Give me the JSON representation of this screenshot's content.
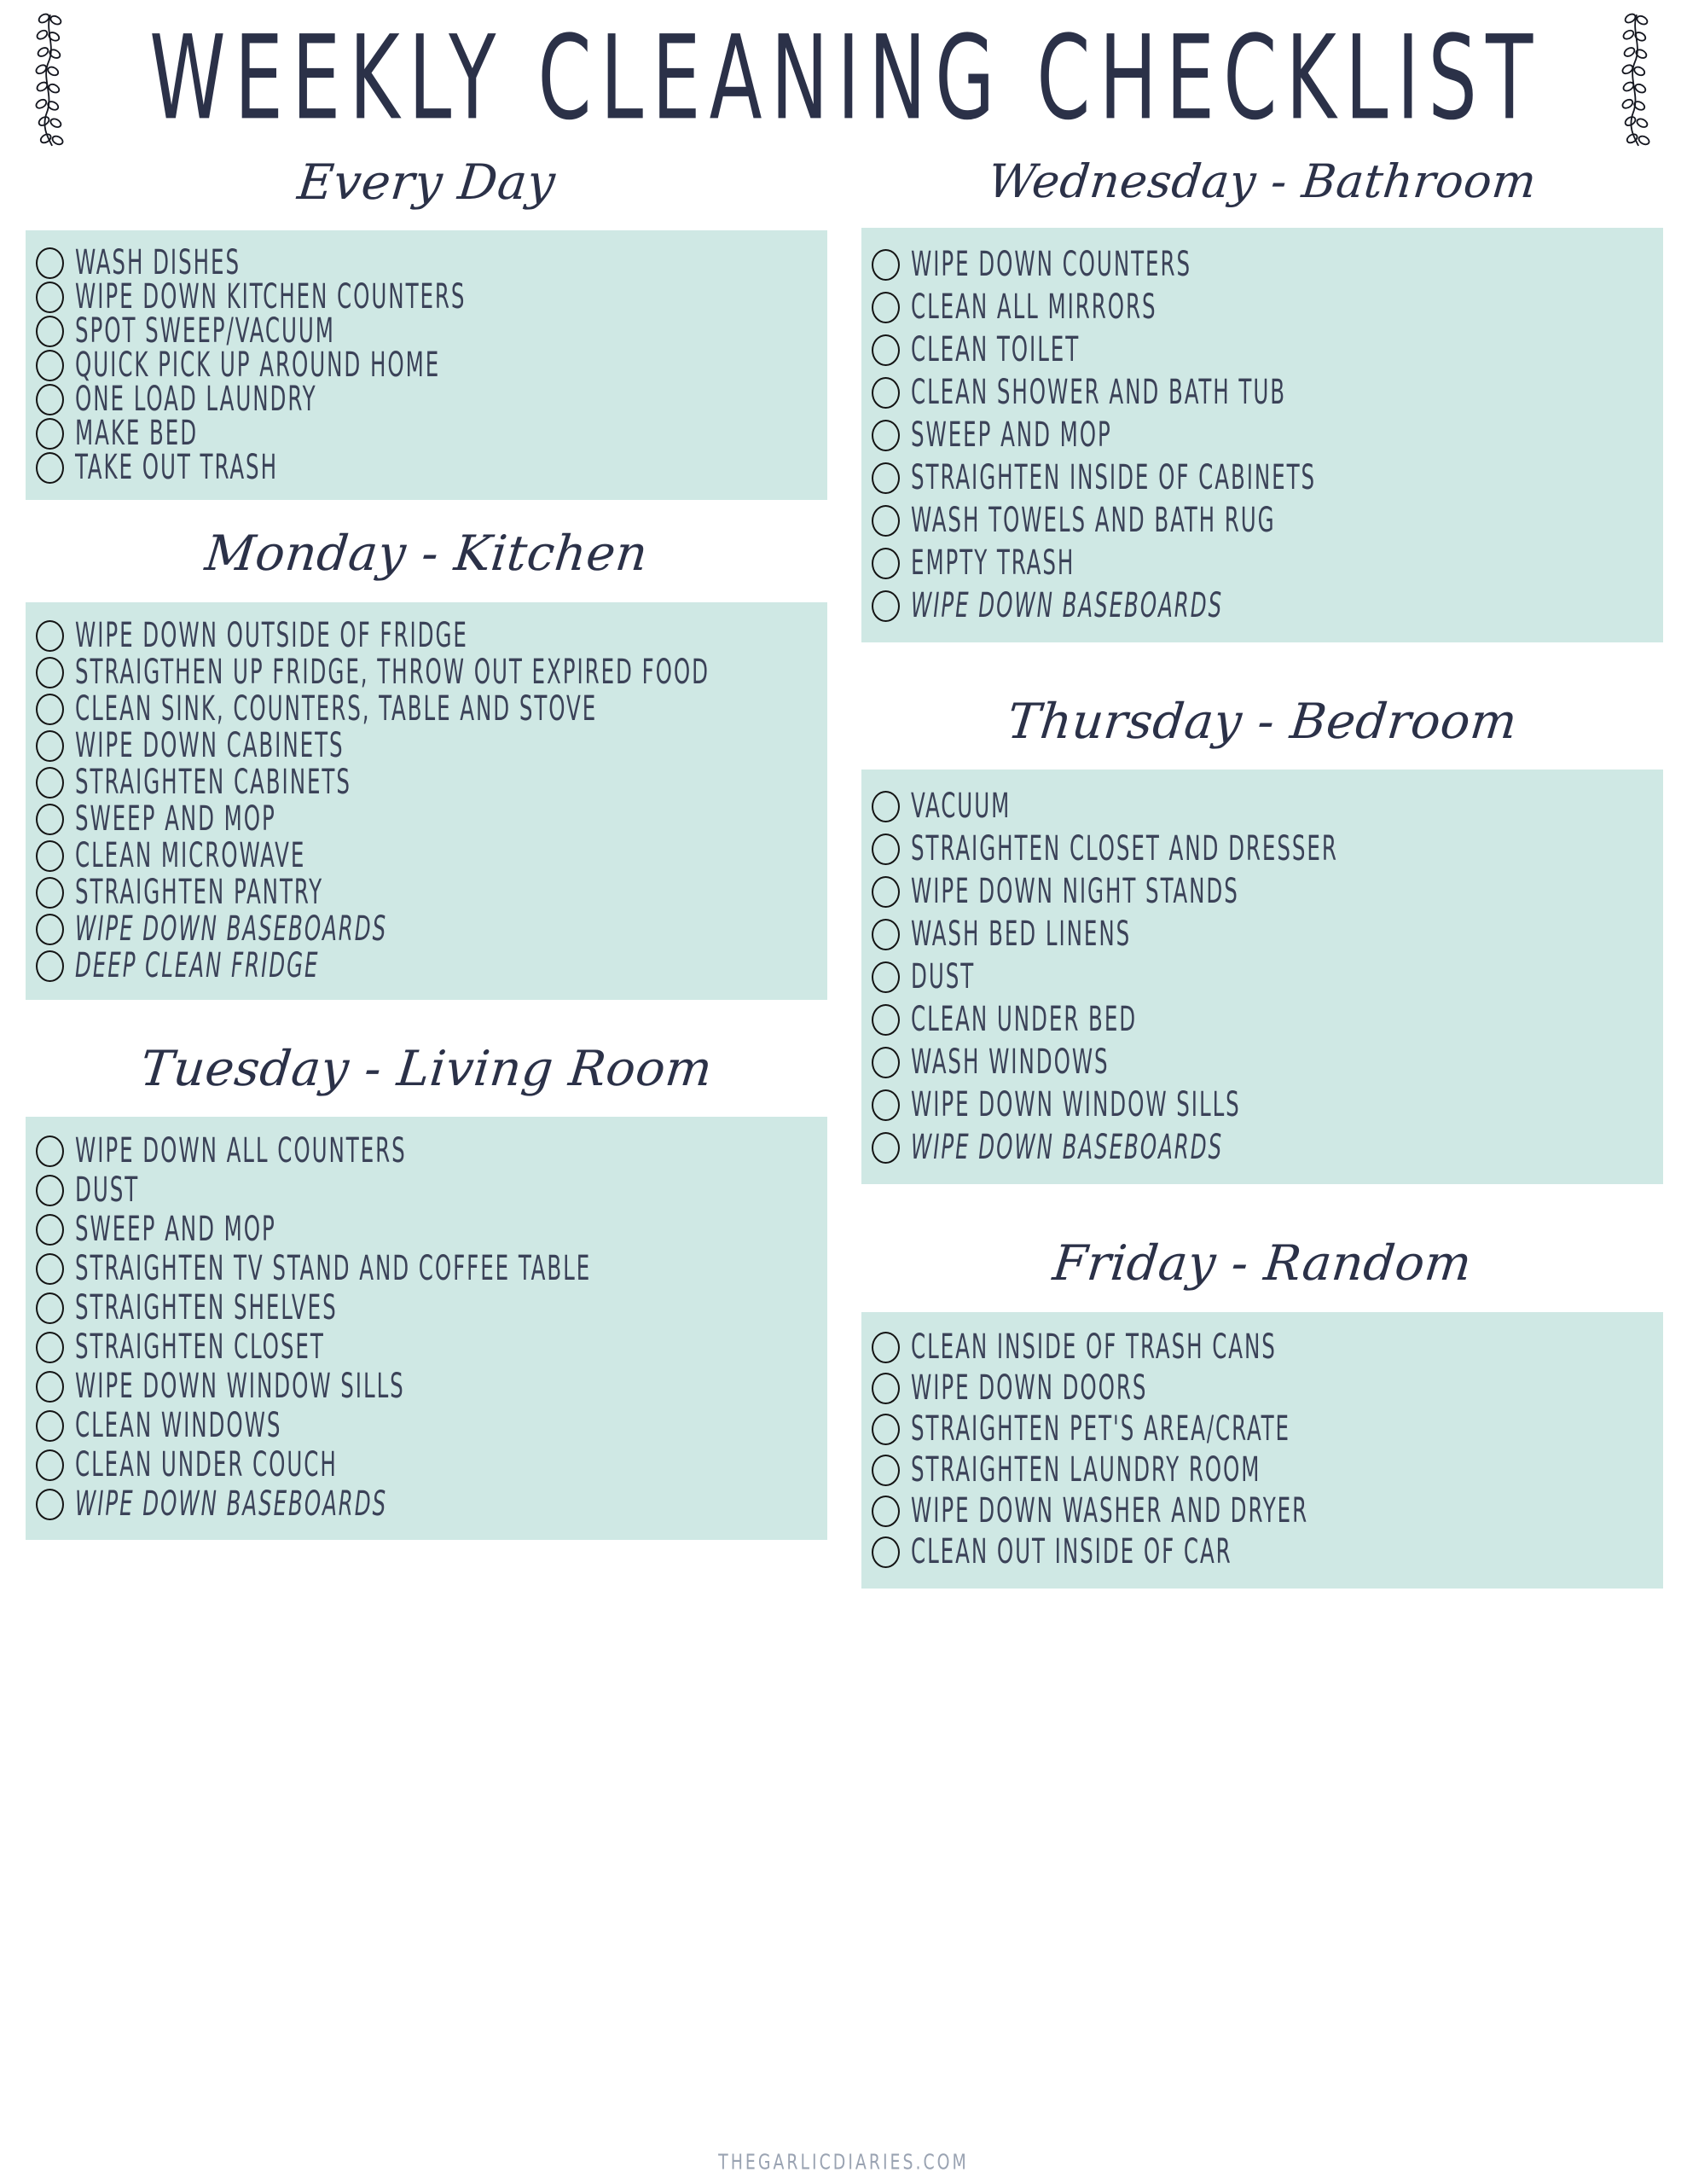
{
  "document": {
    "title": "WEEKLY CLEANING CHECKLIST",
    "footer": "THEGARLICDIARIES.COM",
    "colors": {
      "ink": "#2b3148",
      "item_text": "#3b4258",
      "list_background": "#cfe8e4",
      "page_background": "#ffffff",
      "footer_text": "#9aa3b2"
    },
    "decorations": {
      "left_bracket": "leafy-vine",
      "right_bracket": "leafy-vine"
    }
  },
  "columns": {
    "left": [
      {
        "heading": "Every Day",
        "items": [
          {
            "label": "WASH DISHES",
            "italic": false
          },
          {
            "label": "WIPE DOWN KITCHEN COUNTERS",
            "italic": false
          },
          {
            "label": "SPOT SWEEP/VACUUM",
            "italic": false
          },
          {
            "label": "QUICK PICK UP AROUND HOME",
            "italic": false
          },
          {
            "label": "ONE LOAD LAUNDRY",
            "italic": false
          },
          {
            "label": "MAKE BED",
            "italic": false
          },
          {
            "label": "TAKE OUT TRASH",
            "italic": false
          }
        ]
      },
      {
        "heading": "Monday - Kitchen",
        "items": [
          {
            "label": "WIPE DOWN OUTSIDE OF FRIDGE",
            "italic": false
          },
          {
            "label": "STRAIGTHEN UP FRIDGE, THROW OUT EXPIRED FOOD",
            "italic": false
          },
          {
            "label": "CLEAN SINK, COUNTERS, TABLE AND STOVE",
            "italic": false
          },
          {
            "label": "WIPE DOWN CABINETS",
            "italic": false
          },
          {
            "label": "STRAIGHTEN CABINETS",
            "italic": false
          },
          {
            "label": "SWEEP AND MOP",
            "italic": false
          },
          {
            "label": "CLEAN MICROWAVE",
            "italic": false
          },
          {
            "label": "STRAIGHTEN PANTRY",
            "italic": false
          },
          {
            "label": "WIPE DOWN BASEBOARDS",
            "italic": true
          },
          {
            "label": "DEEP CLEAN FRIDGE",
            "italic": true
          }
        ]
      },
      {
        "heading": "Tuesday - Living Room",
        "items": [
          {
            "label": "WIPE DOWN ALL COUNTERS",
            "italic": false
          },
          {
            "label": "DUST",
            "italic": false
          },
          {
            "label": "SWEEP AND MOP",
            "italic": false
          },
          {
            "label": "STRAIGHTEN TV STAND AND COFFEE TABLE",
            "italic": false
          },
          {
            "label": "STRAIGHTEN SHELVES",
            "italic": false
          },
          {
            "label": "STRAIGHTEN CLOSET",
            "italic": false
          },
          {
            "label": "WIPE DOWN WINDOW SILLS",
            "italic": false
          },
          {
            "label": "CLEAN WINDOWS",
            "italic": false
          },
          {
            "label": "CLEAN UNDER COUCH",
            "italic": false
          },
          {
            "label": "WIPE DOWN BASEBOARDS",
            "italic": true
          }
        ]
      }
    ],
    "right": [
      {
        "heading": "Wednesday - Bathroom",
        "items": [
          {
            "label": "WIPE DOWN COUNTERS",
            "italic": false
          },
          {
            "label": "CLEAN ALL MIRRORS",
            "italic": false
          },
          {
            "label": "CLEAN TOILET",
            "italic": false
          },
          {
            "label": "CLEAN SHOWER AND BATH TUB",
            "italic": false
          },
          {
            "label": "SWEEP AND MOP",
            "italic": false
          },
          {
            "label": "STRAIGHTEN INSIDE OF CABINETS",
            "italic": false
          },
          {
            "label": "WASH TOWELS AND BATH RUG",
            "italic": false
          },
          {
            "label": "EMPTY TRASH",
            "italic": false
          },
          {
            "label": "WIPE DOWN BASEBOARDS",
            "italic": true
          }
        ]
      },
      {
        "heading": "Thursday - Bedroom",
        "items": [
          {
            "label": "VACUUM",
            "italic": false
          },
          {
            "label": "STRAIGHTEN CLOSET AND DRESSER",
            "italic": false
          },
          {
            "label": "WIPE DOWN NIGHT STANDS",
            "italic": false
          },
          {
            "label": "WASH BED LINENS",
            "italic": false
          },
          {
            "label": "DUST",
            "italic": false
          },
          {
            "label": "CLEAN UNDER BED",
            "italic": false
          },
          {
            "label": "WASH WINDOWS",
            "italic": false
          },
          {
            "label": "WIPE DOWN WINDOW SILLS",
            "italic": false
          },
          {
            "label": "WIPE DOWN BASEBOARDS",
            "italic": true
          }
        ]
      },
      {
        "heading": "Friday - Random",
        "items": [
          {
            "label": "CLEAN INSIDE OF TRASH CANS",
            "italic": false
          },
          {
            "label": "WIPE DOWN DOORS",
            "italic": false
          },
          {
            "label": "STRAIGHTEN PET'S AREA/CRATE",
            "italic": false
          },
          {
            "label": "STRAIGHTEN LAUNDRY ROOM",
            "italic": false
          },
          {
            "label": "WIPE DOWN WASHER AND DRYER",
            "italic": false
          },
          {
            "label": "CLEAN OUT INSIDE OF CAR",
            "italic": false
          }
        ]
      }
    ]
  }
}
